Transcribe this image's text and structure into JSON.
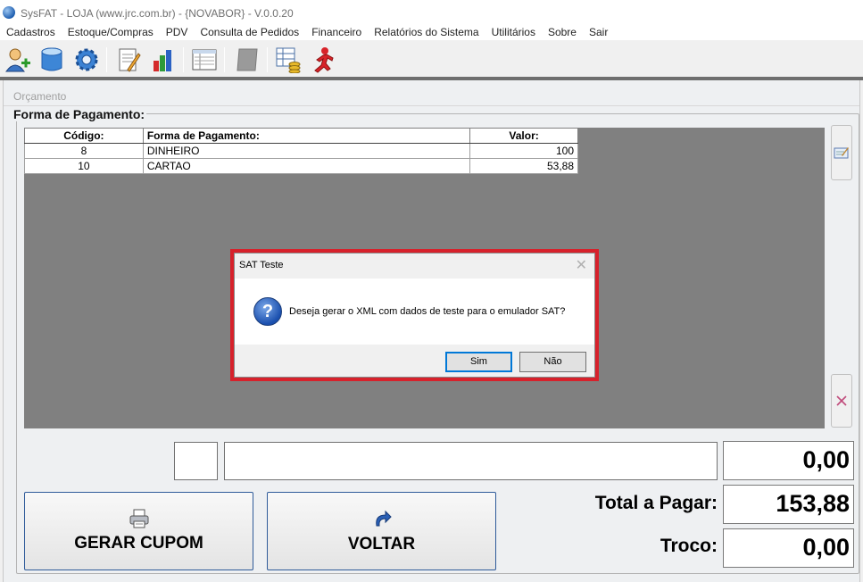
{
  "window": {
    "title": "SysFAT - LOJA (www.jrc.com.br) - {NOVABOR} - V.0.0.20"
  },
  "menu": [
    "Cadastros",
    "Estoque/Compras",
    "PDV",
    "Consulta de Pedidos",
    "Financeiro",
    "Relatórios do Sistema",
    "Utilitários",
    "Sobre",
    "Sair"
  ],
  "toolbar": {
    "icons": [
      "add-user-icon",
      "database-icon",
      "settings-gear-icon",
      "notepad-pencil-icon",
      "bar-chart-icon",
      "list-form-icon",
      "gray-card-icon",
      "table-coins-icon",
      "red-runner-icon"
    ]
  },
  "breadcrumb": "Orçamento",
  "group_title": "Forma de Pagamento:",
  "table": {
    "headers": [
      "Código:",
      "Forma de Pagamento:",
      "Valor:"
    ],
    "rows": [
      [
        "8",
        "DINHEIRO",
        "100"
      ],
      [
        "10",
        "CARTAO",
        "53,88"
      ]
    ]
  },
  "amounts": {
    "entry_value": "0,00",
    "total_label": "Total a Pagar:",
    "total_value": "153,88",
    "troco_label": "Troco:",
    "troco_value": "0,00"
  },
  "buttons": {
    "gerar_cupom": "GERAR CUPOM",
    "voltar": "VOLTAR"
  },
  "dialog": {
    "title": "SAT Teste",
    "message": "Deseja gerar o XML com dados de teste para o emulador SAT?",
    "yes": "Sim",
    "no": "Não"
  },
  "colors": {
    "dialog_highlight": "#d7212b",
    "grid_background": "#808080",
    "button_border": "#2f5b9a"
  }
}
